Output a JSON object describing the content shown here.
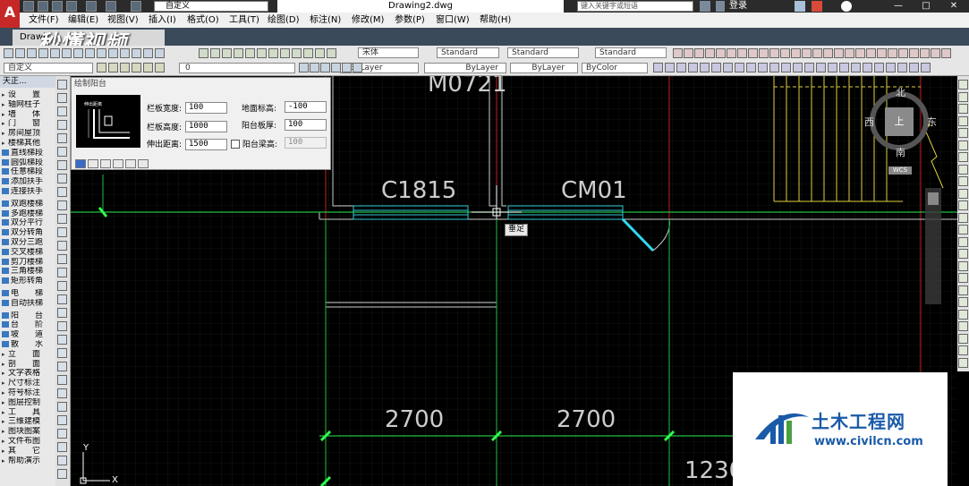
{
  "window": {
    "document_title": "Drawing2.dwg",
    "search_placeholder": "键入关键字或短语",
    "login_label": "登录",
    "workspace_dropdown": "自定义",
    "minimize": "—",
    "restore": "□",
    "close": "✕"
  },
  "menu": [
    "文件(F)",
    "编辑(E)",
    "视图(V)",
    "插入(I)",
    "格式(O)",
    "工具(T)",
    "绘图(D)",
    "标注(N)",
    "修改(M)",
    "参数(P)",
    "窗口(W)",
    "帮助(H)"
  ],
  "tab": {
    "label": "Drawi"
  },
  "watermark": "秒懂视频",
  "toolbar1": {
    "text_style_font": "宋体",
    "text_style": "Standard",
    "dim_style": "Standard",
    "table_style": "Standard"
  },
  "toolbar2": {
    "workspace": "自定义",
    "layer": "0",
    "color": "ByLayer",
    "linetype": "ByLayer",
    "lineweight": "ByLayer",
    "plotstyle": "ByColor"
  },
  "left_panel": {
    "title": "天正...",
    "items": [
      {
        "label": "设　　置",
        "type": "cat"
      },
      {
        "label": "轴网柱子",
        "type": "cat"
      },
      {
        "label": "墙　　体",
        "type": "cat"
      },
      {
        "label": "门　　窗",
        "type": "cat"
      },
      {
        "label": "房间屋顶",
        "type": "cat"
      },
      {
        "label": "楼梯其他",
        "type": "cat"
      },
      {
        "label": "直线梯段",
        "type": "sub"
      },
      {
        "label": "圆弧梯段",
        "type": "sub"
      },
      {
        "label": "任意梯段",
        "type": "sub"
      },
      {
        "label": "添加扶手",
        "type": "sub"
      },
      {
        "label": "连接扶手",
        "type": "sub"
      },
      {
        "label": "",
        "type": "gap"
      },
      {
        "label": "双跑楼梯",
        "type": "sub"
      },
      {
        "label": "多跑楼梯",
        "type": "sub"
      },
      {
        "label": "双分平行",
        "type": "sub"
      },
      {
        "label": "双分转角",
        "type": "sub"
      },
      {
        "label": "双分三跑",
        "type": "sub"
      },
      {
        "label": "交叉楼梯",
        "type": "sub"
      },
      {
        "label": "剪刀楼梯",
        "type": "sub"
      },
      {
        "label": "三角楼梯",
        "type": "sub"
      },
      {
        "label": "矩形转角",
        "type": "sub"
      },
      {
        "label": "",
        "type": "gap"
      },
      {
        "label": "电　　梯",
        "type": "sub"
      },
      {
        "label": "自动扶梯",
        "type": "sub"
      },
      {
        "label": "",
        "type": "gap"
      },
      {
        "label": "阳　　台",
        "type": "sub"
      },
      {
        "label": "台　　阶",
        "type": "sub"
      },
      {
        "label": "坡　　道",
        "type": "sub"
      },
      {
        "label": "散　　水",
        "type": "sub"
      },
      {
        "label": "立　　面",
        "type": "cat"
      },
      {
        "label": "剖　　面",
        "type": "cat"
      },
      {
        "label": "文字表格",
        "type": "cat"
      },
      {
        "label": "尺寸标注",
        "type": "cat"
      },
      {
        "label": "符号标注",
        "type": "cat"
      },
      {
        "label": "图层控制",
        "type": "cat"
      },
      {
        "label": "工　　具",
        "type": "cat"
      },
      {
        "label": "三维建模",
        "type": "cat"
      },
      {
        "label": "图块图案",
        "type": "cat"
      },
      {
        "label": "文件布图",
        "type": "cat"
      },
      {
        "label": "其　　它",
        "type": "cat"
      },
      {
        "label": "帮助演示",
        "type": "cat"
      }
    ]
  },
  "dialog": {
    "title": "绘制阳台",
    "preview_label": "伸出距离",
    "railing_width_label": "栏板宽度:",
    "railing_width": "100",
    "floor_elevation_label": "地面标高:",
    "floor_elevation": "-100",
    "railing_height_label": "栏板高度:",
    "railing_height": "1000",
    "slab_thickness_label": "阳台板厚:",
    "slab_thickness": "100",
    "extension_label": "伸出距离:",
    "extension": "1500",
    "beam_height_label": "阳台梁高:",
    "beam_height": "100"
  },
  "drawing": {
    "labels": {
      "top_door": "M0721",
      "window": "C1815",
      "door_window": "CM01",
      "dim_left": "2700",
      "dim_right": "2700",
      "dim_bottom": "1230"
    },
    "tooltip": "垂足",
    "axis_y": "Y",
    "axis_x": "X"
  },
  "compass": {
    "north": "北",
    "west": "西",
    "south": "南",
    "east": "东",
    "center": "上",
    "wcs": "WCS"
  },
  "logo": {
    "name": "土木工程网",
    "url": "www.civilcn.com"
  }
}
